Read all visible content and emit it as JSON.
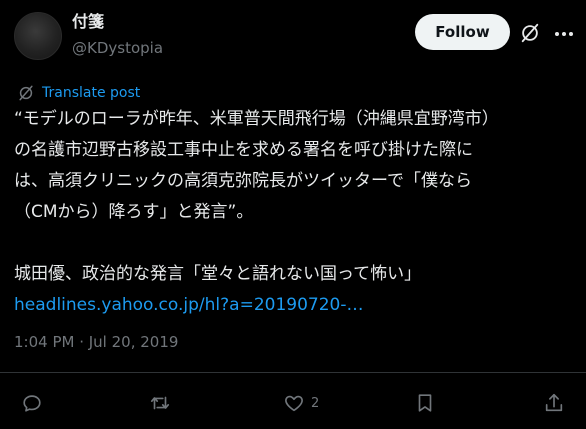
{
  "author": {
    "display_name": "付箋",
    "handle": "@KDystopia"
  },
  "header": {
    "follow_label": "Follow"
  },
  "translate": {
    "label": "Translate post"
  },
  "post": {
    "line1": "“モデルのローラが昨年、米軍普天間飛行場（沖縄県宜野湾市）",
    "line2": "の名護市辺野古移設工事中止を求める署名を呼び掛けた際に",
    "line3": "は、高須クリニックの高須克弥院長がツイッターで「僕なら",
    "line4": "（CMから）降ろす」と発言”。",
    "line5": "城田優、政治的な発言「堂々と語れない国って怖い」",
    "link": "headlines.yahoo.co.jp/hl?a=20190720-…",
    "timestamp": "1:04 PM · Jul 20, 2019"
  },
  "actions": {
    "like_count": "2"
  },
  "colors": {
    "background": "#000000",
    "text": "#e7e9ea",
    "secondary": "#71767b",
    "link": "#1d9bf0",
    "follow_bg": "#eff3f4"
  }
}
